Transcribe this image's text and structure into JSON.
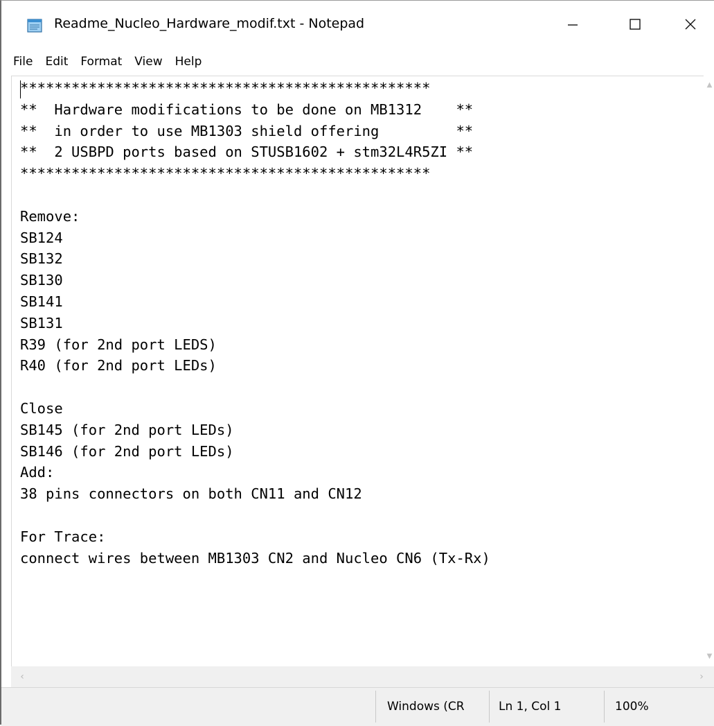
{
  "window": {
    "title": "Readme_Nucleo_Hardware_modif.txt - Notepad",
    "icon": "notepad-icon",
    "controls": {
      "minimize_icon": "minimize-icon",
      "maximize_icon": "maximize-icon",
      "close_icon": "close-icon"
    }
  },
  "menu": {
    "items": [
      {
        "label": "File"
      },
      {
        "label": "Edit"
      },
      {
        "label": "Format"
      },
      {
        "label": "View"
      },
      {
        "label": "Help"
      }
    ]
  },
  "editor": {
    "content": "************************************************\n**  Hardware modifications to be done on MB1312    **\n**  in order to use MB1303 shield offering         **\n**  2 USBPD ports based on STUSB1602 + stm32L4R5ZI **\n************************************************\n\nRemove:\nSB124\nSB132\nSB130\nSB141\nSB131\nR39 (for 2nd port LEDS)\nR40 (for 2nd port LEDs)\n\nClose\nSB145 (for 2nd port LEDs)\nSB146 (for 2nd port LEDs)\nAdd:\n38 pins connectors on both CN11 and CN12\n\nFor Trace:\nconnect wires between MB1303 CN2 and Nucleo CN6 (Tx-Rx)"
  },
  "statusbar": {
    "line_ending": "Windows (CR",
    "position": "Ln 1, Col 1",
    "zoom": "100%"
  },
  "colors": {
    "background": "#ffffff",
    "statusbar": "#f0f0f0",
    "text": "#000000",
    "scroll_arrow": "#c4c4c4"
  }
}
